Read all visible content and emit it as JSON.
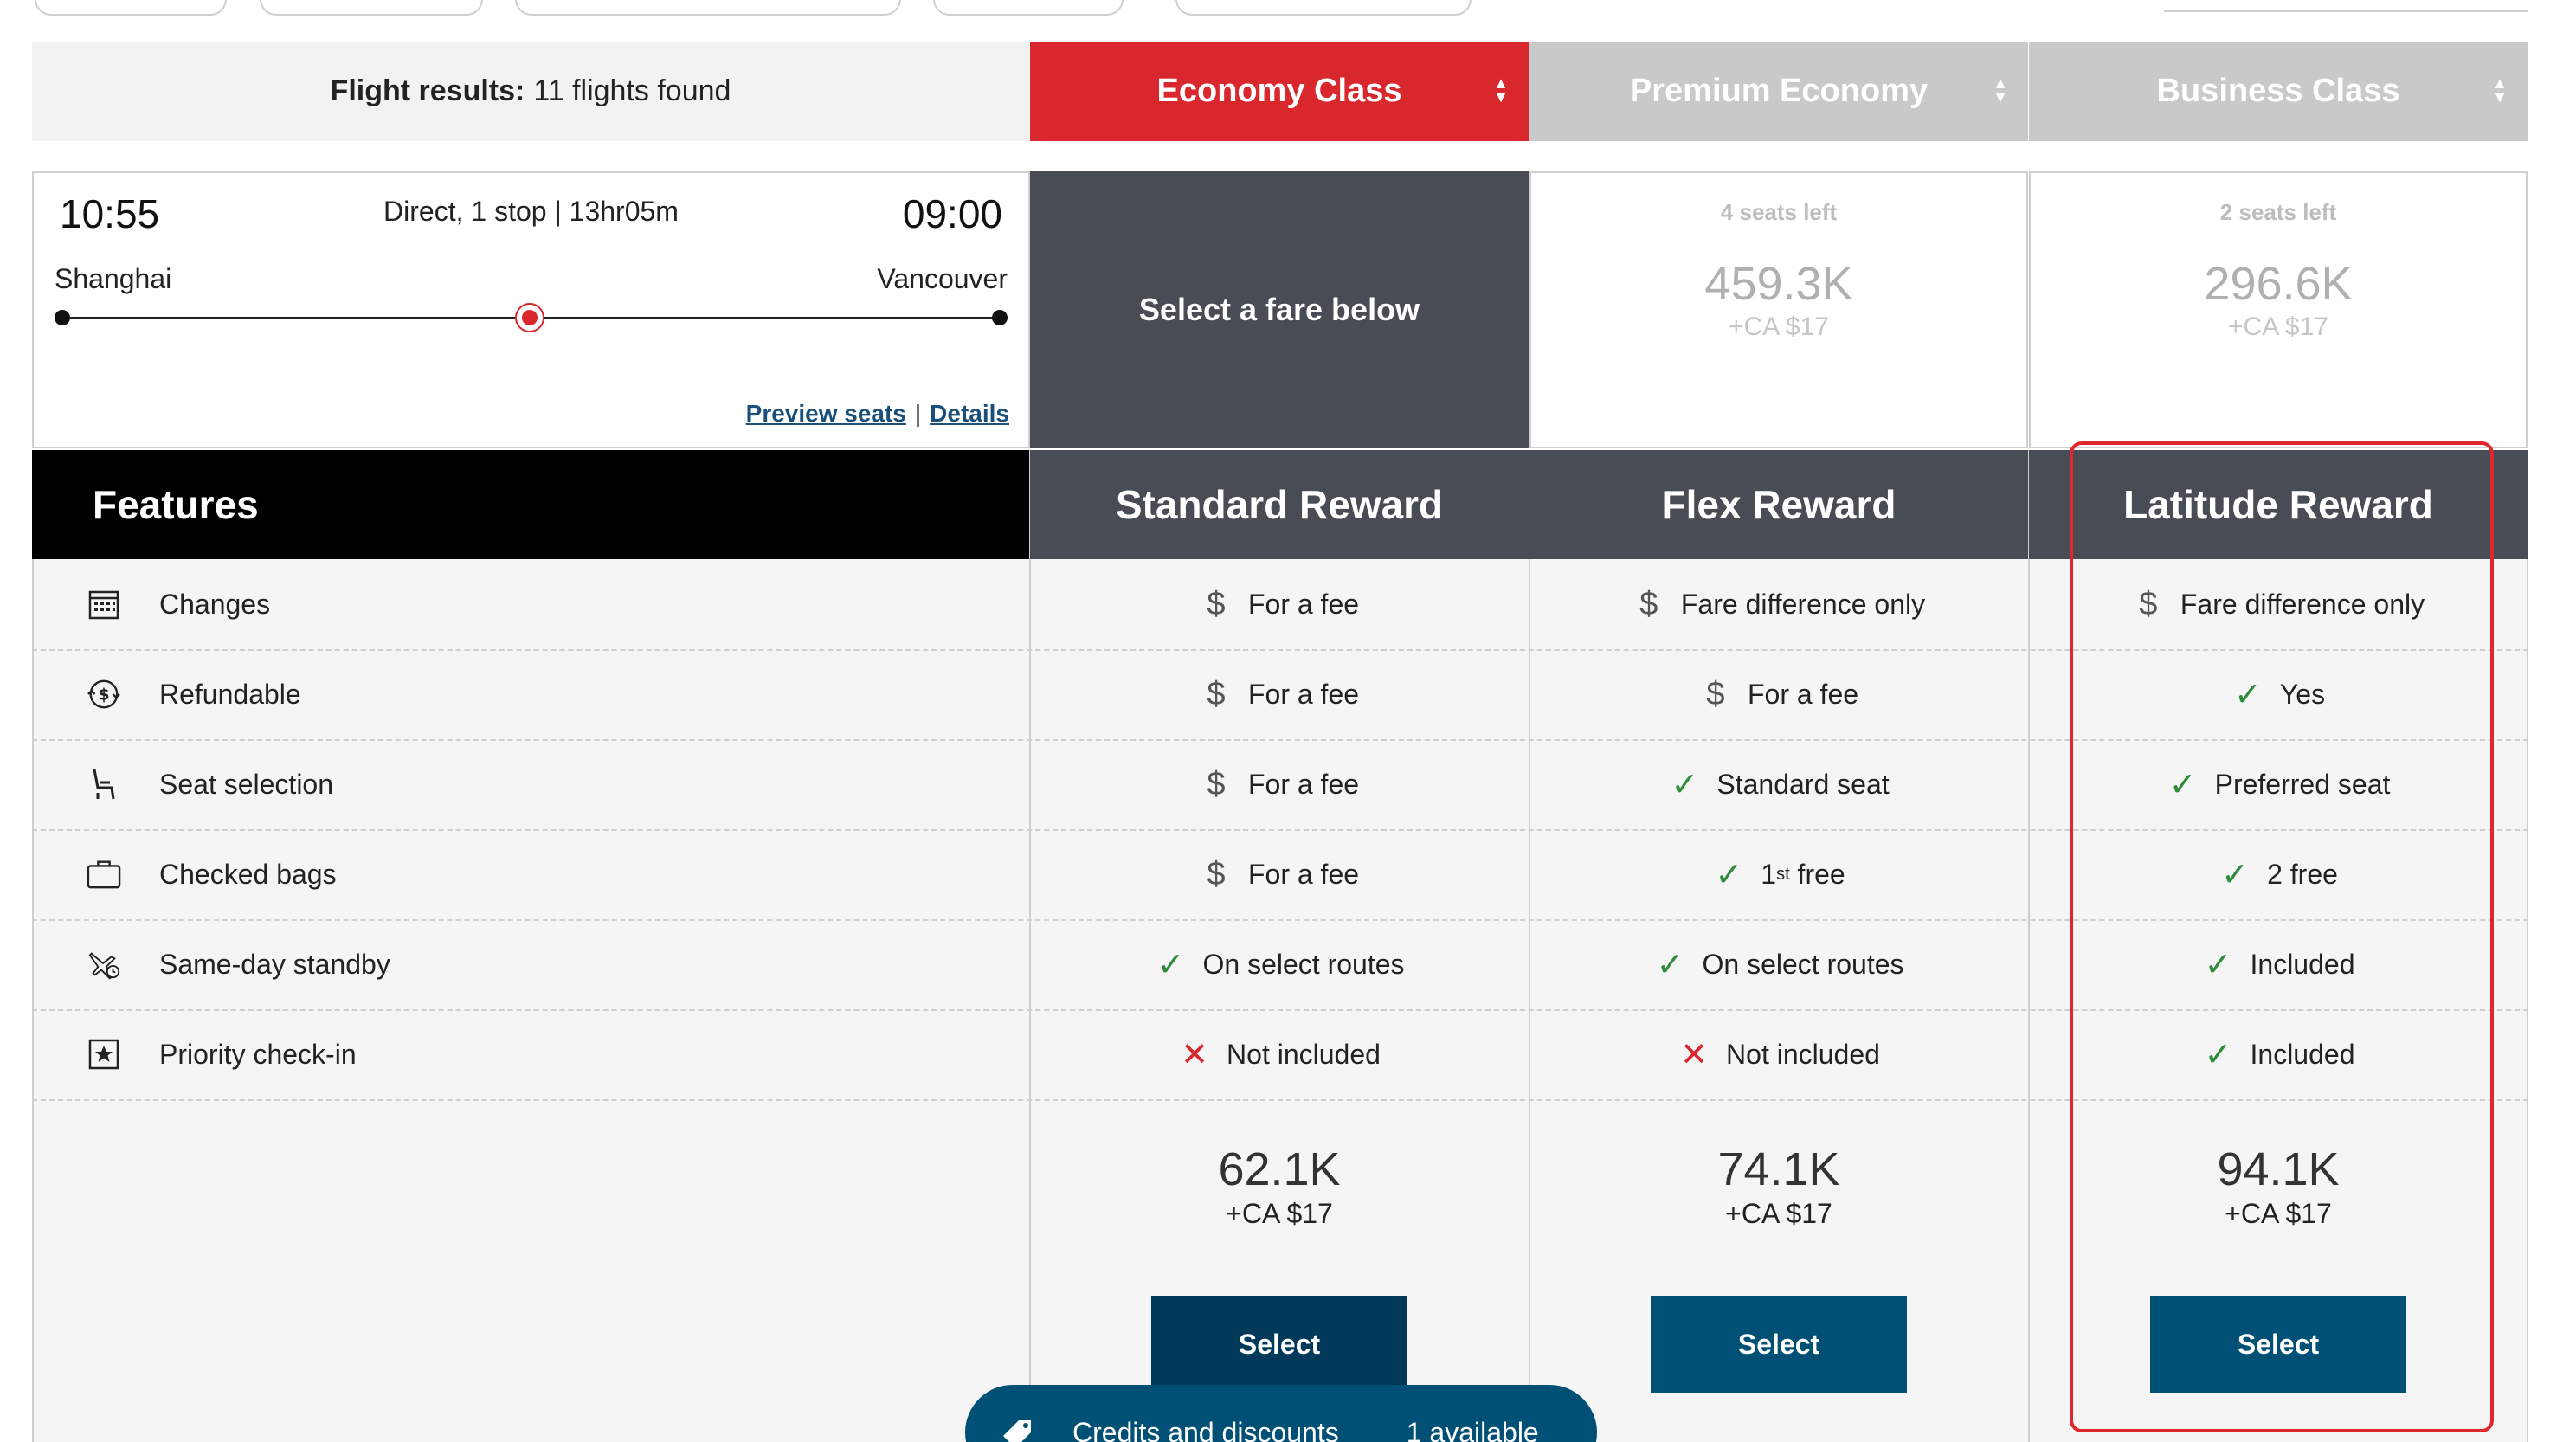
{
  "header": {
    "results_label": "Flight results:",
    "results_count": "11 flights found",
    "tabs": [
      {
        "label": "Economy Class",
        "active": true
      },
      {
        "label": "Premium Economy",
        "active": false
      },
      {
        "label": "Business Class",
        "active": false
      }
    ]
  },
  "flight": {
    "departure_time": "10:55",
    "arrival_time": "09:00",
    "summary": "Direct, 1 stop | 13hr05m",
    "from_city": "Shanghai",
    "to_city": "Vancouver",
    "preview_seats": "Preview seats",
    "separator": "|",
    "details": "Details"
  },
  "fares": {
    "economy_prompt": "Select a fare below",
    "premium": {
      "seats": "4 seats left",
      "points": "459.3K",
      "tax": "+CA $17"
    },
    "business": {
      "seats": "2 seats left",
      "points": "296.6K",
      "tax": "+CA $17"
    }
  },
  "table": {
    "features_title": "Features",
    "columns": [
      "Standard Reward",
      "Flex Reward",
      "Latitude Reward"
    ],
    "rows": [
      {
        "feature": "Changes",
        "icon": "calendar-icon",
        "standard": {
          "mark": "fee",
          "text": "For a fee"
        },
        "flex": {
          "mark": "fee",
          "text": "Fare difference only"
        },
        "latitude": {
          "mark": "fee",
          "text": "Fare difference only"
        }
      },
      {
        "feature": "Refundable",
        "icon": "refund-icon",
        "standard": {
          "mark": "fee",
          "text": "For a fee"
        },
        "flex": {
          "mark": "fee",
          "text": "For a fee"
        },
        "latitude": {
          "mark": "yes",
          "text": "Yes"
        }
      },
      {
        "feature": "Seat selection",
        "icon": "seat-icon",
        "standard": {
          "mark": "fee",
          "text": "For a fee"
        },
        "flex": {
          "mark": "yes",
          "text": "Standard seat"
        },
        "latitude": {
          "mark": "yes",
          "text": "Preferred seat"
        }
      },
      {
        "feature": "Checked bags",
        "icon": "suitcase-icon",
        "standard": {
          "mark": "fee",
          "text": "For a fee"
        },
        "flex": {
          "mark": "yes",
          "text_pre": "1",
          "text_sup": "st",
          "text": " free"
        },
        "latitude": {
          "mark": "yes",
          "text": "2 free"
        }
      },
      {
        "feature": "Same-day standby",
        "icon": "standby-plane-icon",
        "standard": {
          "mark": "yes",
          "text": "On select routes"
        },
        "flex": {
          "mark": "yes",
          "text": "On select routes"
        },
        "latitude": {
          "mark": "yes",
          "text": "Included"
        }
      },
      {
        "feature": "Priority check-in",
        "icon": "star-badge-icon",
        "standard": {
          "mark": "no",
          "text": "Not included"
        },
        "flex": {
          "mark": "no",
          "text": "Not included"
        },
        "latitude": {
          "mark": "yes",
          "text": "Included"
        }
      }
    ],
    "prices": [
      {
        "points": "62.1K",
        "tax": "+CA $17"
      },
      {
        "points": "74.1K",
        "tax": "+CA $17"
      },
      {
        "points": "94.1K",
        "tax": "+CA $17"
      }
    ],
    "select_label": "Select"
  },
  "credits": {
    "label": "Credits and discounts",
    "available": "1 available"
  },
  "marks": {
    "fee": "$",
    "yes": "✓",
    "no": "✕"
  },
  "colors": {
    "brand_red": "#d9272e",
    "dark_button": "#005076",
    "header_gray": "#484d55"
  }
}
